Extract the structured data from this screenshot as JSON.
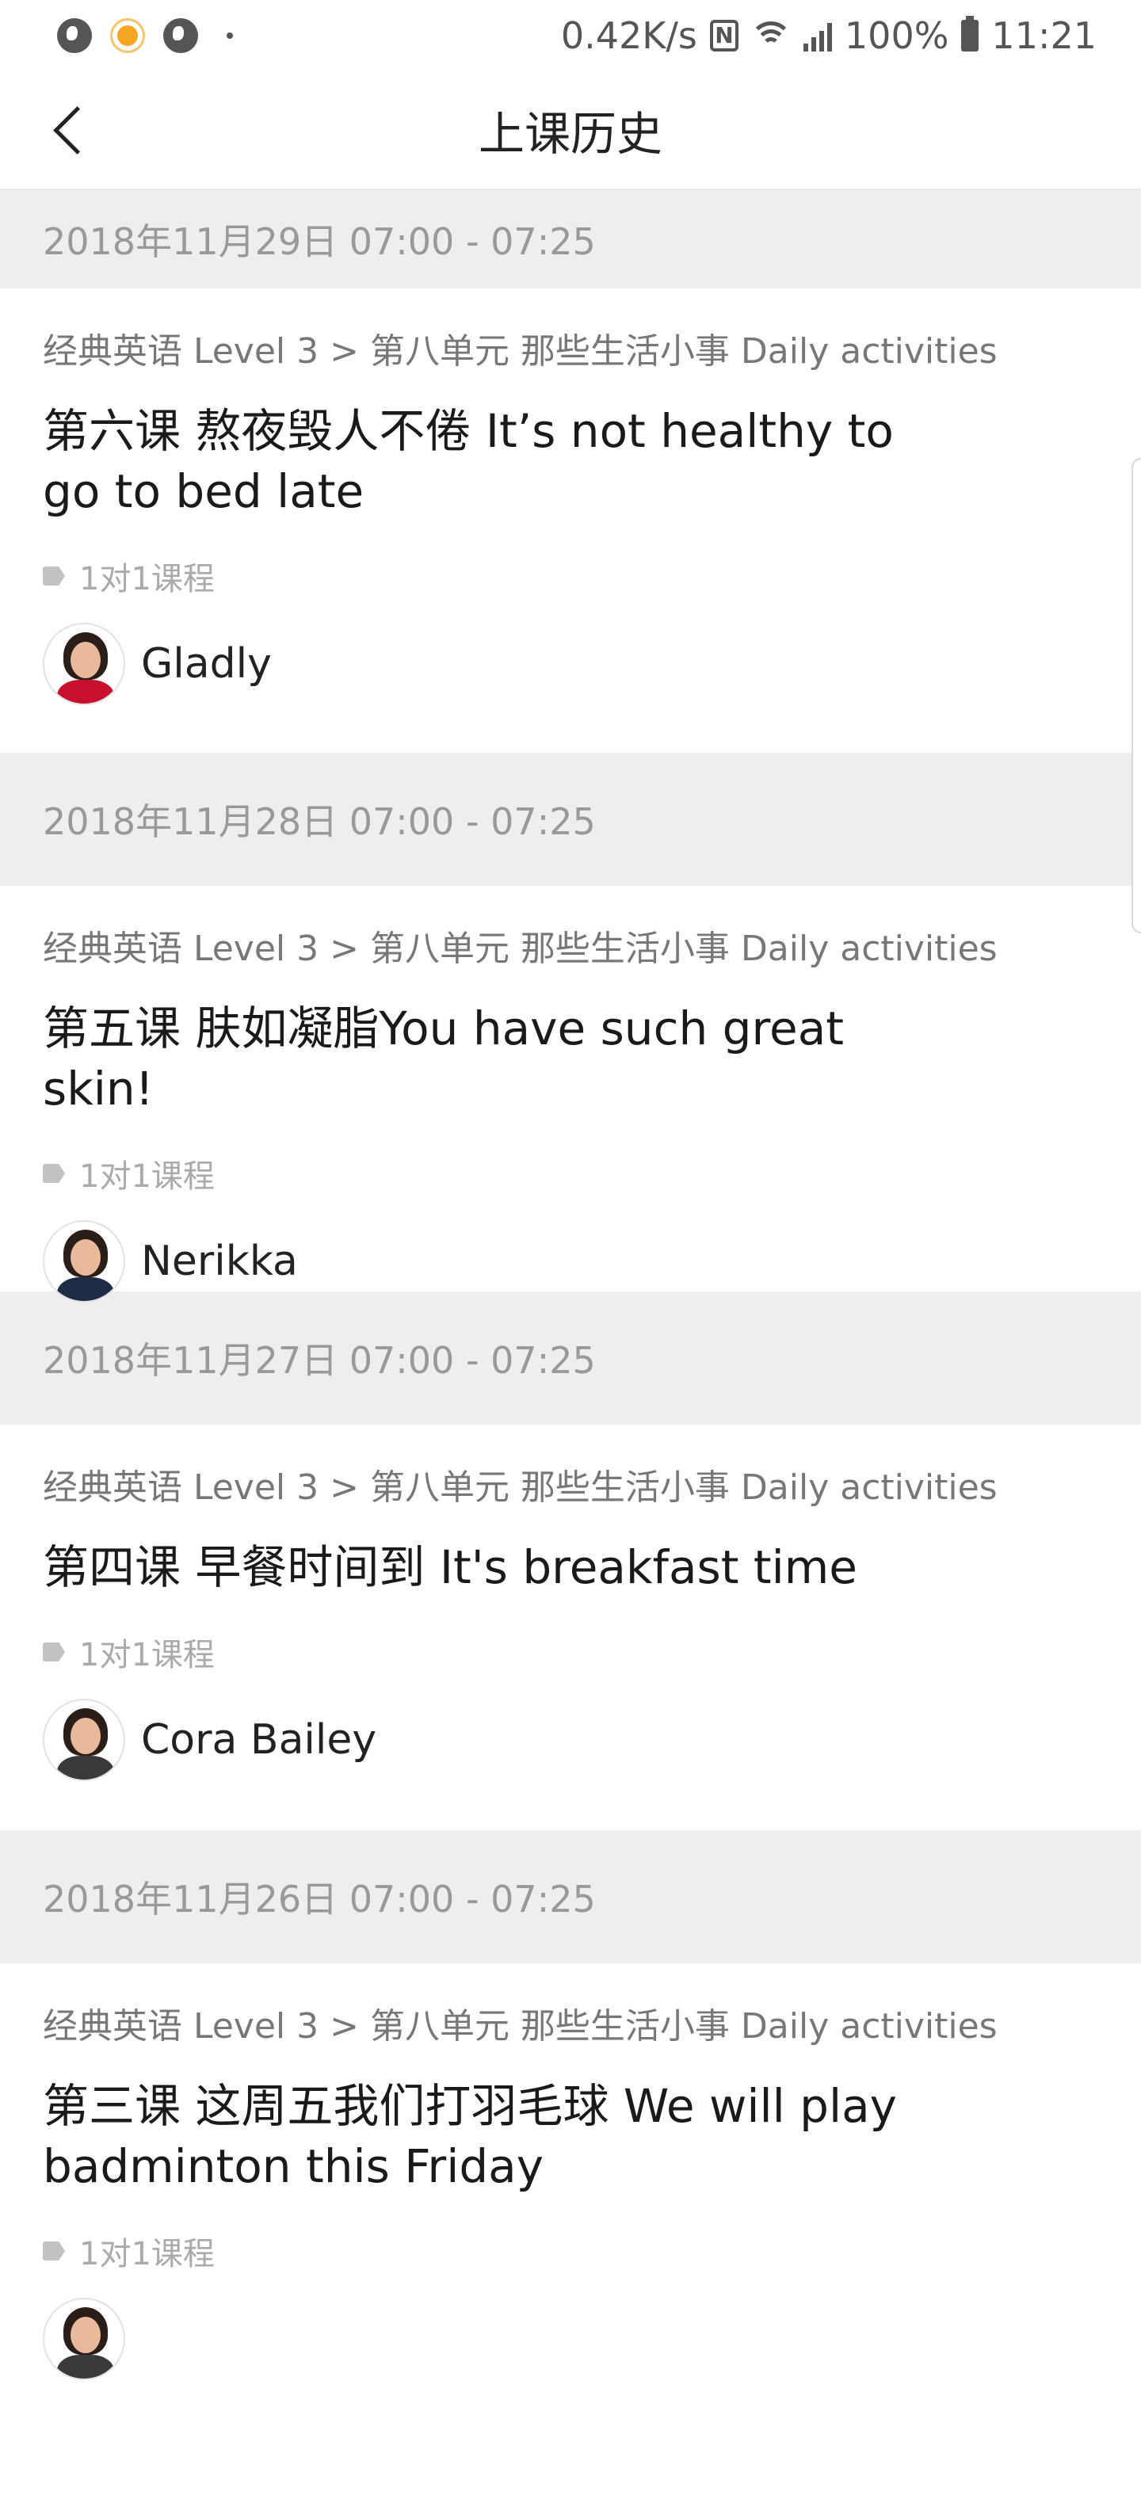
{
  "status_bar": {
    "net_speed": "0.42K/s",
    "network": "4G",
    "battery": "100%",
    "time": "11:21"
  },
  "header": {
    "title": "上课历史"
  },
  "colors": {
    "date_band_bg": "#eeeeee",
    "date_text": "#999999",
    "tag_text": "#aaaaaa"
  },
  "lessons": [
    {
      "date": "2018年11月29日 07:00 - 07:25",
      "course_path": "经典英语 Level 3 > 第八单元 那些生活小事 Daily activities",
      "title": "第六课 熬夜毁人不倦 It’s not healthy to go to bed late",
      "tag": "1对1课程",
      "teacher": "Gladly",
      "avatar_outfit": "#c8102e"
    },
    {
      "date": "2018年11月28日 07:00 - 07:25",
      "course_path": "经典英语 Level 3 > 第八单元 那些生活小事 Daily activities",
      "title": "第五课 肤如凝脂You have such great skin!",
      "tag": "1对1课程",
      "teacher": "Nerikka",
      "avatar_outfit": "#1f2a44"
    },
    {
      "date": "2018年11月27日 07:00 - 07:25",
      "course_path": "经典英语 Level 3 > 第八单元 那些生活小事 Daily activities",
      "title": "第四课 早餐时间到 It's breakfast time",
      "tag": "1对1课程",
      "teacher": "Cora Bailey",
      "avatar_outfit": "#3a3a3a"
    },
    {
      "date": "2018年11月26日 07:00 - 07:25",
      "course_path": "经典英语 Level 3 > 第八单元 那些生活小事 Daily activities",
      "title": "第三课 这周五我们打羽毛球 We will play badminton this Friday",
      "tag": "1对1课程",
      "teacher": "",
      "avatar_outfit": "#3a3a3a"
    }
  ]
}
